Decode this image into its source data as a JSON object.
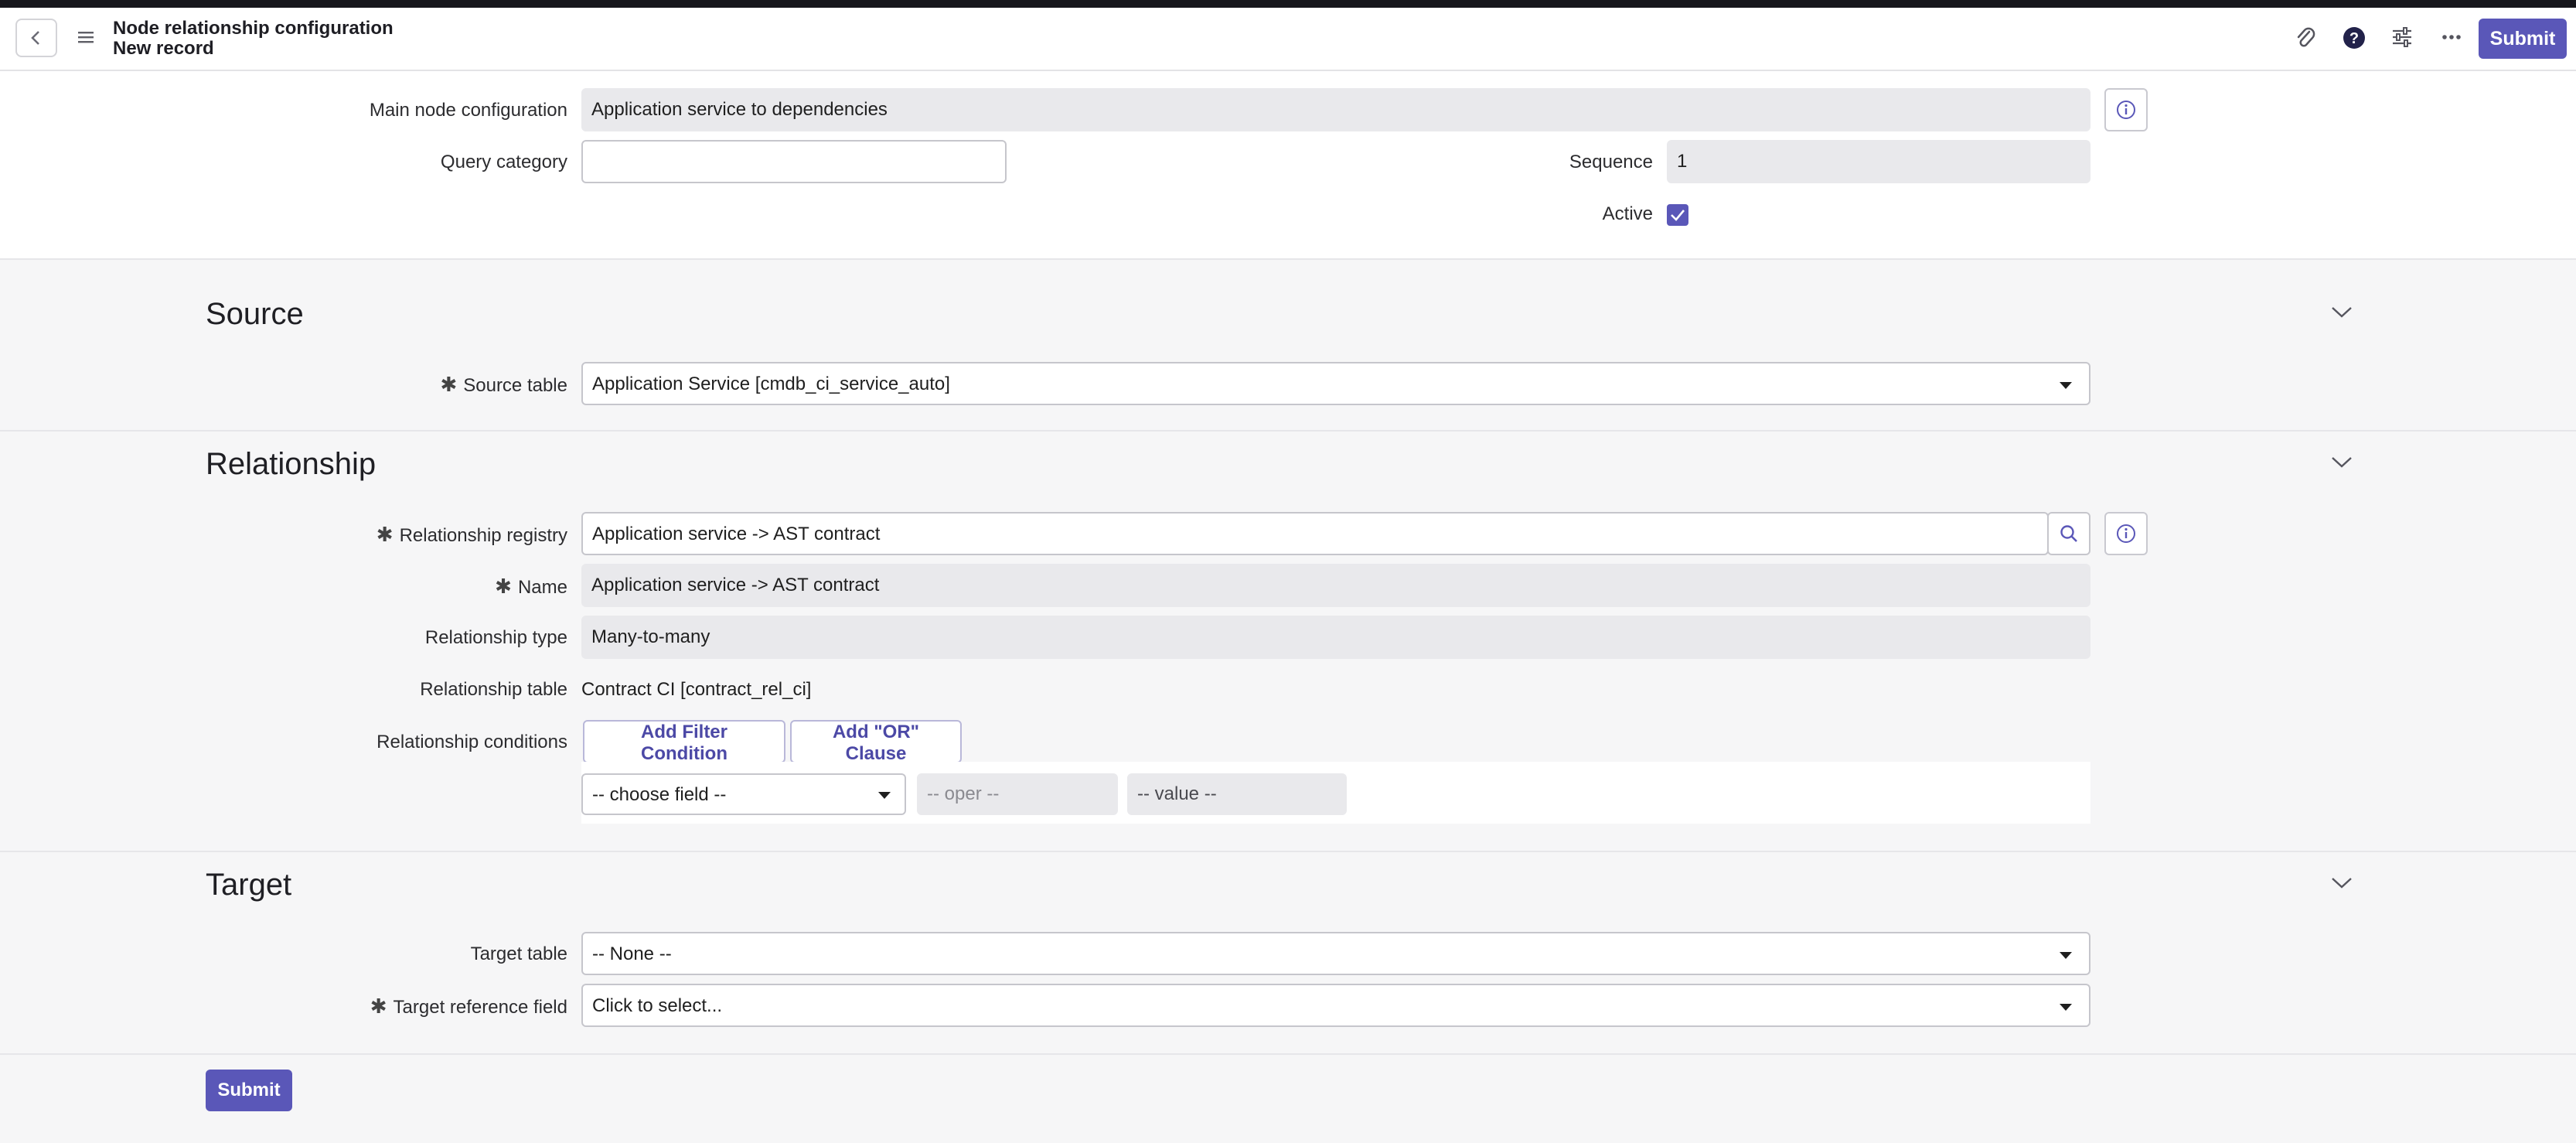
{
  "header": {
    "title": "Node relationship configuration",
    "subtitle": "New record",
    "submit_label": "Submit",
    "icons": [
      "back-icon",
      "menu-icon",
      "paperclip-icon",
      "help-icon",
      "settings-sliders-icon",
      "more-icon"
    ]
  },
  "top": {
    "main_node_label": "Main node configuration",
    "main_node_value": "Application service to dependencies",
    "query_category_label": "Query category",
    "query_category_value": "",
    "sequence_label": "Sequence",
    "sequence_value": "1",
    "active_label": "Active",
    "active_checked": true
  },
  "source": {
    "title": "Source",
    "source_table_label": "Source table",
    "source_table_value": "Application Service [cmdb_ci_service_auto]"
  },
  "relationship": {
    "title": "Relationship",
    "registry_label": "Relationship registry",
    "registry_value": "Application service -> AST contract",
    "name_label": "Name",
    "name_value": "Application service -> AST contract",
    "type_label": "Relationship type",
    "type_value": "Many-to-many",
    "table_label": "Relationship table",
    "table_value": "Contract CI [contract_rel_ci]",
    "conditions_label": "Relationship conditions",
    "add_filter_label": "Add Filter Condition",
    "add_or_label": "Add \"OR\" Clause",
    "choose_field": "-- choose field --",
    "oper": "-- oper --",
    "value": "-- value --"
  },
  "target": {
    "title": "Target",
    "target_table_label": "Target table",
    "target_table_value": "-- None --",
    "target_ref_label": "Target reference field",
    "target_ref_value": "Click to select..."
  },
  "footer": {
    "submit_label": "Submit"
  },
  "colors": {
    "accent": "#5a57b8",
    "readonly_bg": "#e9e9ec",
    "section_bg": "#f6f6f7"
  }
}
